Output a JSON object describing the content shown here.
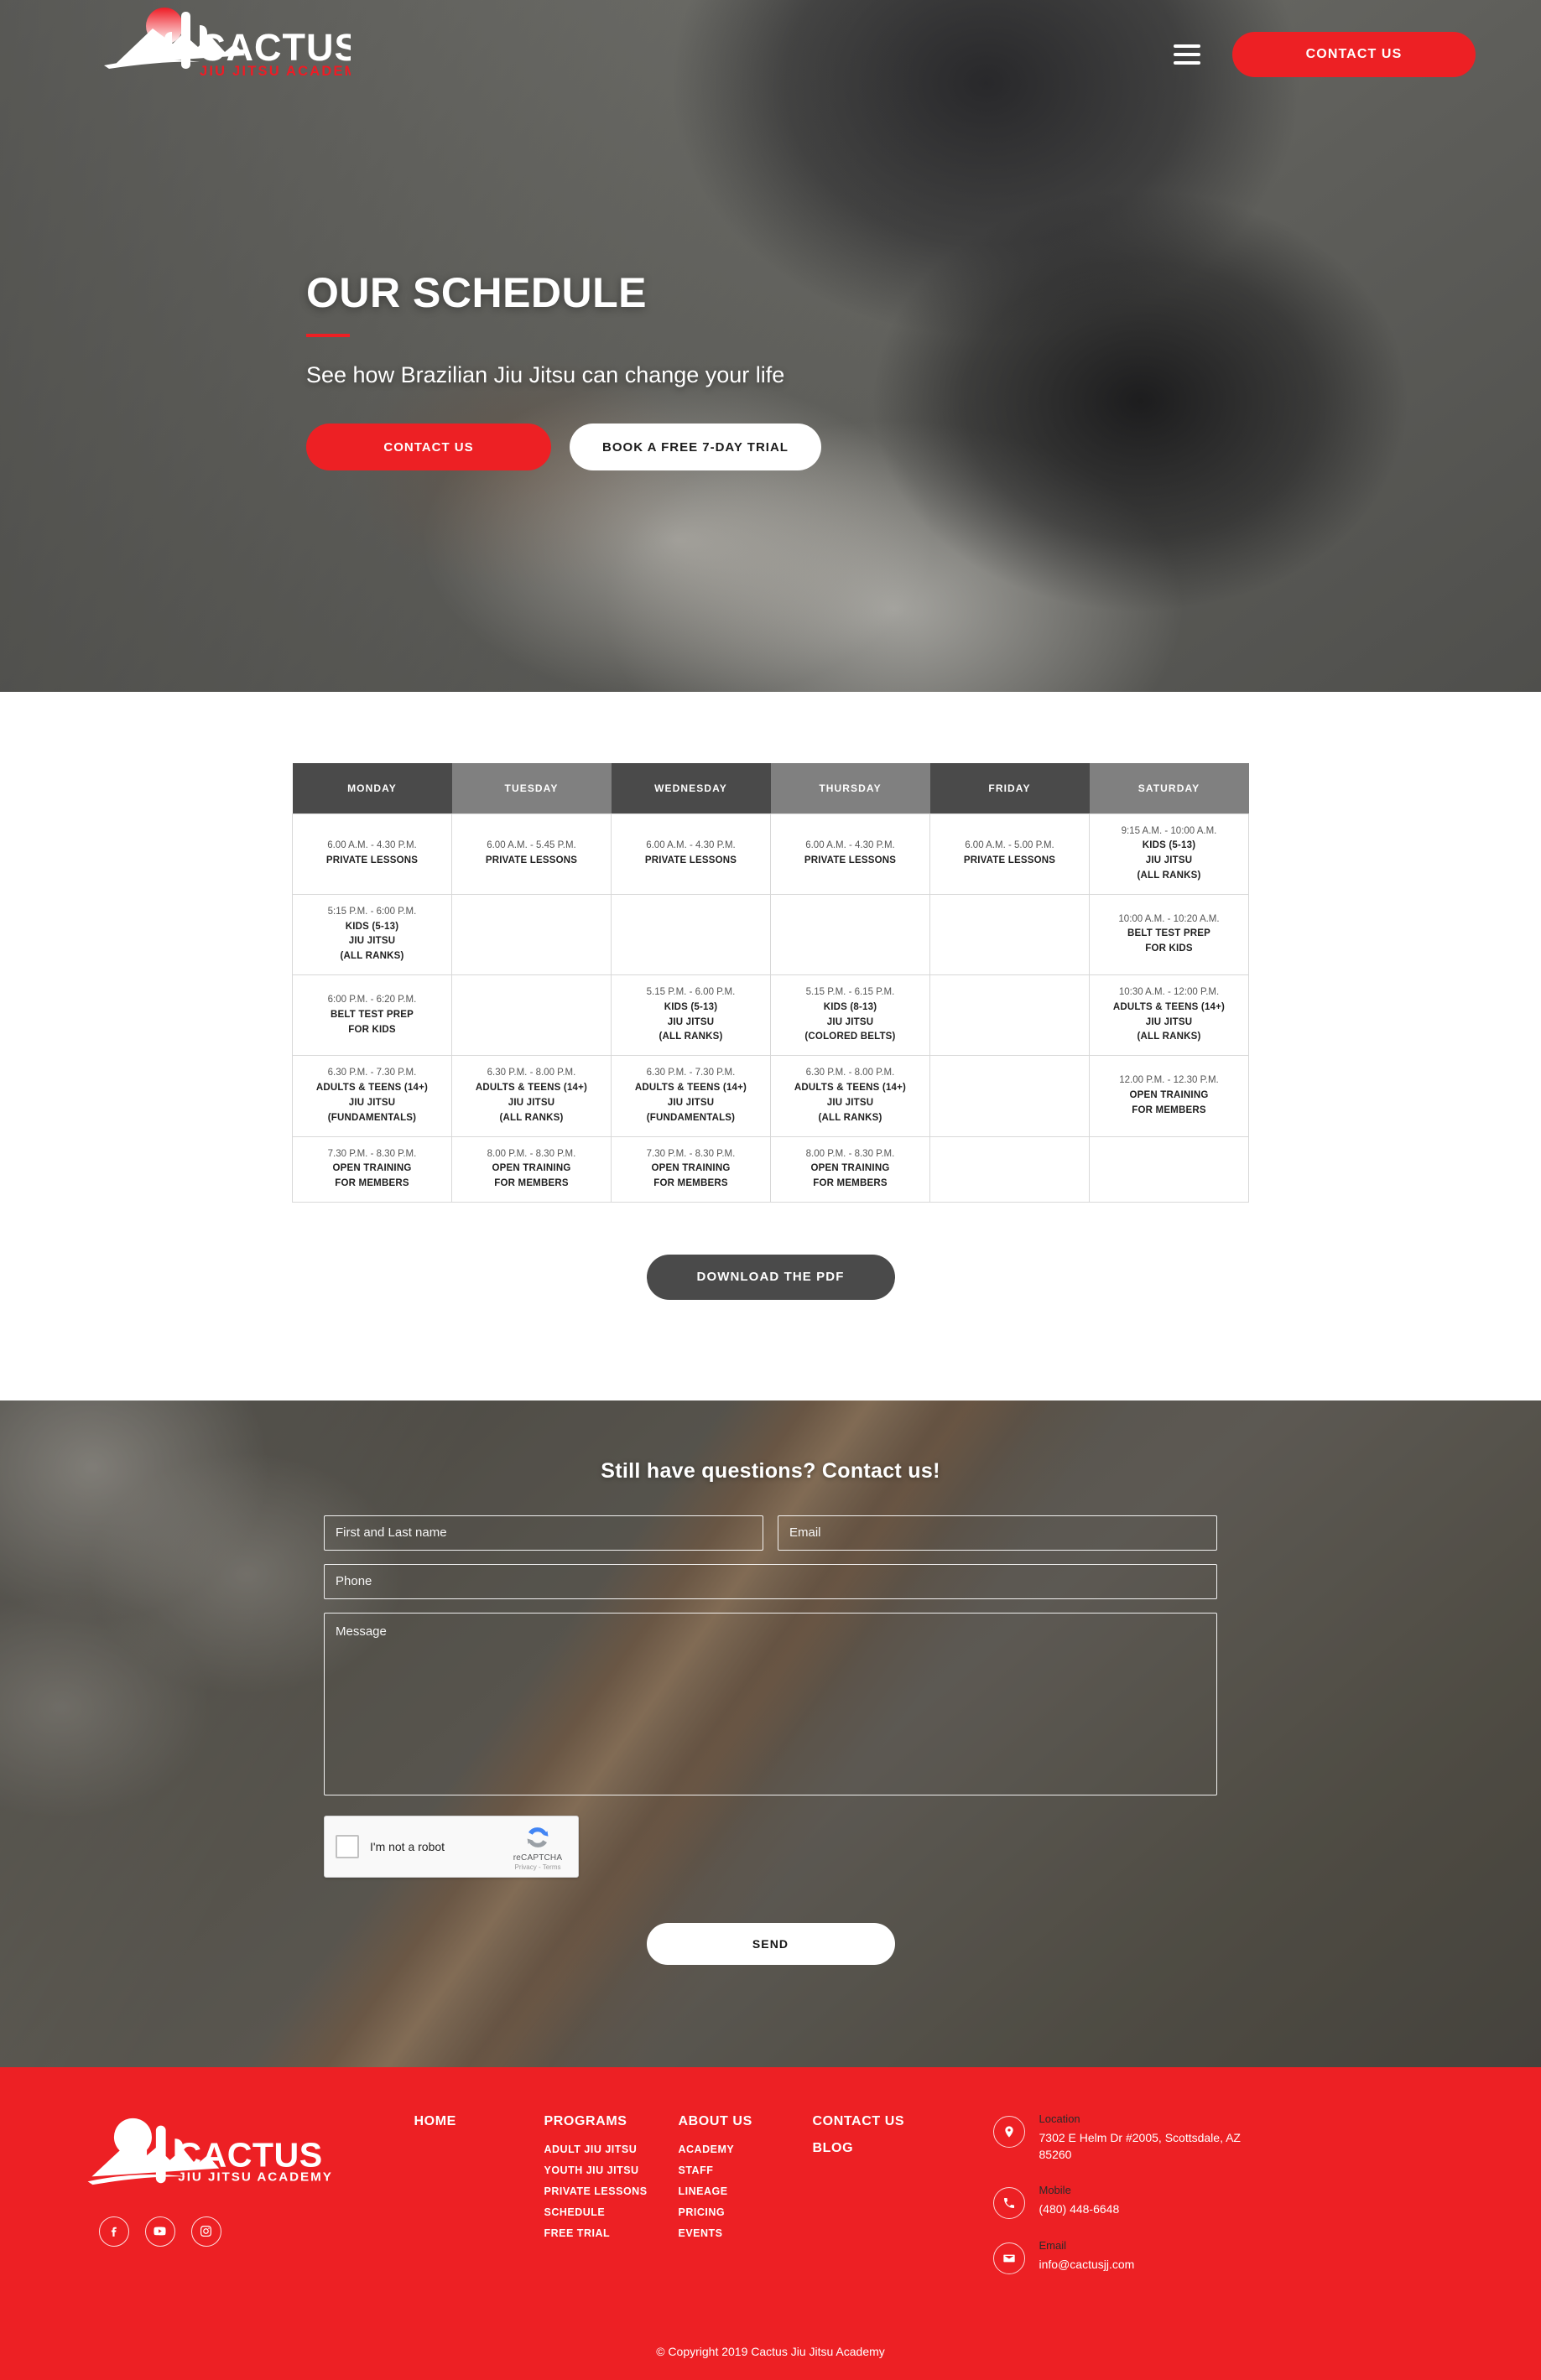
{
  "brand": {
    "name": "CACTUS",
    "tagline": "JIU JITSU ACADEMY",
    "accent": "#ED2024"
  },
  "header": {
    "menu_icon": "hamburger-icon",
    "contact_button": "CONTACT US"
  },
  "hero": {
    "title": "OUR SCHEDULE",
    "subtitle": "See how Brazilian Jiu Jitsu can change your life",
    "primary_button": "CONTACT US",
    "secondary_button": "BOOK A FREE 7-DAY TRIAL"
  },
  "schedule": {
    "columns": [
      "MONDAY",
      "TUESDAY",
      "WEDNESDAY",
      "THURSDAY",
      "FRIDAY",
      "SATURDAY"
    ],
    "rows": [
      [
        {
          "time": "6.00 A.M. - 4.30 P.M.",
          "lines": [
            "PRIVATE LESSONS"
          ]
        },
        {
          "time": "6.00 A.M. - 5.45 P.M.",
          "lines": [
            "PRIVATE LESSONS"
          ]
        },
        {
          "time": "6.00 A.M. - 4.30 P.M.",
          "lines": [
            "PRIVATE LESSONS"
          ]
        },
        {
          "time": "6.00 A.M. - 4.30 P.M.",
          "lines": [
            "PRIVATE LESSONS"
          ]
        },
        {
          "time": "6.00 A.M. - 5.00 P.M.",
          "lines": [
            "PRIVATE LESSONS"
          ]
        },
        {
          "time": "9:15 A.M. - 10:00 A.M.",
          "lines": [
            "KIDS (5-13)",
            "JIU JITSU",
            "(ALL RANKS)"
          ]
        }
      ],
      [
        {
          "time": "5:15 P.M. - 6:00 P.M.",
          "lines": [
            "KIDS (5-13)",
            "JIU JITSU",
            "(ALL RANKS)"
          ]
        },
        {
          "time": "",
          "lines": []
        },
        {
          "time": "",
          "lines": []
        },
        {
          "time": "",
          "lines": []
        },
        {
          "time": "",
          "lines": []
        },
        {
          "time": "10:00 A.M. - 10:20 A.M.",
          "lines": [
            "BELT TEST PREP",
            "FOR KIDS"
          ]
        }
      ],
      [
        {
          "time": "6:00 P.M. - 6:20 P.M.",
          "lines": [
            "BELT TEST PREP",
            "FOR KIDS"
          ]
        },
        {
          "time": "",
          "lines": []
        },
        {
          "time": "5.15 P.M. - 6.00 P.M.",
          "lines": [
            "KIDS (5-13)",
            "JIU JITSU",
            "(ALL RANKS)"
          ]
        },
        {
          "time": "5.15 P.M. - 6.15 P.M.",
          "lines": [
            "KIDS (8-13)",
            "JIU JITSU",
            "(COLORED BELTS)"
          ]
        },
        {
          "time": "",
          "lines": []
        },
        {
          "time": "10:30 A.M. - 12:00 P.M.",
          "lines": [
            "ADULTS & TEENS (14+)",
            "JIU JITSU",
            "(ALL RANKS)"
          ]
        }
      ],
      [
        {
          "time": "6.30 P.M. - 7.30 P.M.",
          "lines": [
            "ADULTS & TEENS (14+)",
            "JIU JITSU",
            "(FUNDAMENTALS)"
          ]
        },
        {
          "time": "6.30 P.M. - 8.00 P.M.",
          "lines": [
            "ADULTS & TEENS (14+)",
            "JIU JITSU",
            "(ALL RANKS)"
          ]
        },
        {
          "time": "6.30 P.M. - 7.30 P.M.",
          "lines": [
            "ADULTS & TEENS (14+)",
            "JIU JITSU",
            "(FUNDAMENTALS)"
          ]
        },
        {
          "time": "6.30 P.M. - 8.00 P.M.",
          "lines": [
            "ADULTS & TEENS (14+)",
            "JIU JITSU",
            "(ALL RANKS)"
          ]
        },
        {
          "time": "",
          "lines": []
        },
        {
          "time": "12.00 P.M. - 12.30 P.M.",
          "lines": [
            "OPEN TRAINING",
            "FOR MEMBERS"
          ]
        }
      ],
      [
        {
          "time": "7.30 P.M. - 8.30 P.M.",
          "lines": [
            "OPEN TRAINING",
            "FOR MEMBERS"
          ]
        },
        {
          "time": "8.00 P.M. - 8.30 P.M.",
          "lines": [
            "OPEN TRAINING",
            "FOR MEMBERS"
          ]
        },
        {
          "time": "7.30 P.M. - 8.30 P.M.",
          "lines": [
            "OPEN TRAINING",
            "FOR MEMBERS"
          ]
        },
        {
          "time": "8.00 P.M. - 8.30 P.M.",
          "lines": [
            "OPEN TRAINING",
            "FOR MEMBERS"
          ]
        },
        {
          "time": "",
          "lines": []
        },
        {
          "time": "",
          "lines": []
        }
      ]
    ],
    "download_button": "DOWNLOAD THE PDF"
  },
  "contact": {
    "heading": "Still have questions? Contact us!",
    "name_placeholder": "First and Last name",
    "email_placeholder": "Email",
    "phone_placeholder": "Phone",
    "message_placeholder": "Message",
    "name_value": "",
    "email_value": "",
    "phone_value": "",
    "message_value": "",
    "captcha_label": "I'm not a robot",
    "captcha_brand": "reCAPTCHA",
    "captcha_terms": "Privacy - Terms",
    "send_button": "SEND"
  },
  "footer": {
    "columns": [
      {
        "heading": "HOME",
        "links": []
      },
      {
        "heading": "PROGRAMS",
        "links": [
          "ADULT JIU JITSU",
          "YOUTH JIU JITSU",
          "PRIVATE LESSONS",
          "SCHEDULE",
          "FREE TRIAL"
        ]
      },
      {
        "heading": "ABOUT US",
        "links": [
          "ACADEMY",
          "STAFF",
          "LINEAGE",
          "PRICING",
          "EVENTS"
        ]
      }
    ],
    "contact_heading": "CONTACT US",
    "blog_heading": "BLOG",
    "socials": [
      "facebook-icon",
      "youtube-icon",
      "instagram-icon"
    ],
    "info": [
      {
        "label": "Location",
        "value": "7302 E Helm Dr #2005, Scottsdale, AZ 85260",
        "icon": "map-pin-icon"
      },
      {
        "label": "Mobile",
        "value": "(480) 448-6648",
        "icon": "phone-icon"
      },
      {
        "label": "Email",
        "value": "info@cactusjj.com",
        "icon": "envelope-icon"
      }
    ],
    "copyright": "© Copyright 2019 Cactus Jiu Jitsu Academy"
  }
}
